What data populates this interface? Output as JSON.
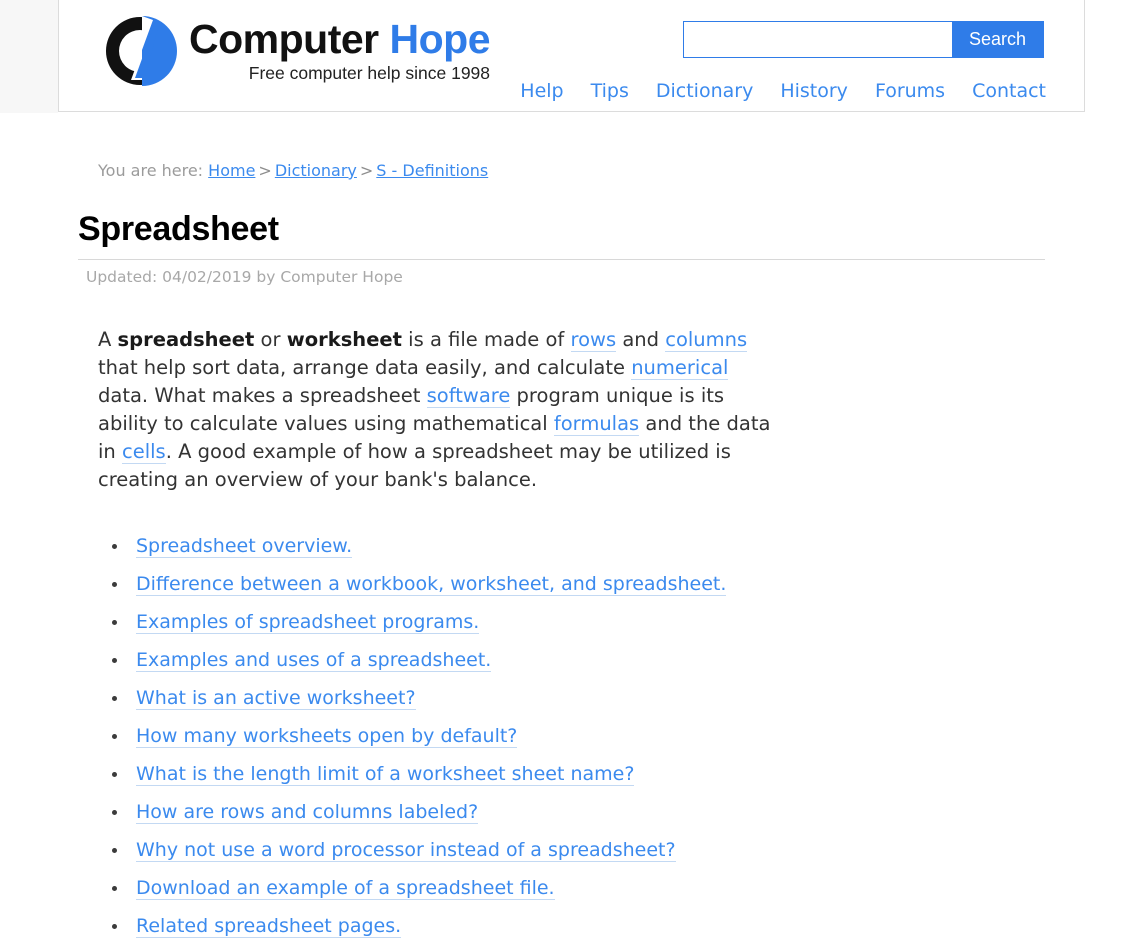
{
  "header": {
    "logo_icon": "computer-hope-logo-icon",
    "brand_name_part1": "Computer",
    "brand_name_part2": "Hope",
    "tagline": "Free computer help since 1998",
    "search": {
      "value": "",
      "placeholder": "",
      "button_label": "Search"
    },
    "nav": [
      {
        "label": "Help"
      },
      {
        "label": "Tips"
      },
      {
        "label": "Dictionary"
      },
      {
        "label": "History"
      },
      {
        "label": "Forums"
      },
      {
        "label": "Contact"
      }
    ]
  },
  "breadcrumb": {
    "prefix": "You are here:",
    "items": [
      {
        "label": "Home"
      },
      {
        "label": "Dictionary"
      },
      {
        "label": "S - Definitions"
      }
    ],
    "separator": ">"
  },
  "article": {
    "title": "Spreadsheet",
    "updated": "Updated: 04/02/2019 by Computer Hope",
    "intro": {
      "t1": "A ",
      "b1": "spreadsheet",
      "t2": " or ",
      "b2": "worksheet",
      "t3": " is a file made of ",
      "l1": "rows",
      "t4": " and ",
      "l2": "columns",
      "t5": " that help sort data, arrange data easily, and calculate ",
      "l3": "numerical",
      "t6": " data. What makes a spreadsheet ",
      "l4": "software",
      "t7": " program unique is its ability to calculate values using mathematical ",
      "l5": "formulas",
      "t8": " and the data in ",
      "l6": "cells",
      "t9": ". A good example of how a spreadsheet may be utilized is creating an overview of your bank's balance."
    },
    "links": [
      {
        "label": "Spreadsheet overview."
      },
      {
        "label": "Difference between a workbook, worksheet, and spreadsheet."
      },
      {
        "label": "Examples of spreadsheet programs."
      },
      {
        "label": "Examples and uses of a spreadsheet."
      },
      {
        "label": "What is an active worksheet?"
      },
      {
        "label": "How many worksheets open by default?"
      },
      {
        "label": "What is the length limit of a worksheet sheet name?"
      },
      {
        "label": "How are rows and columns labeled?"
      },
      {
        "label": "Why not use a word processor instead of a spreadsheet?"
      },
      {
        "label": "Download an example of a spreadsheet file."
      },
      {
        "label": "Related spreadsheet pages."
      }
    ]
  },
  "colors": {
    "link_blue": "#3b8aee",
    "brand_blue": "#2f7ce8",
    "text": "#333333",
    "muted": "#a8a8a8"
  }
}
